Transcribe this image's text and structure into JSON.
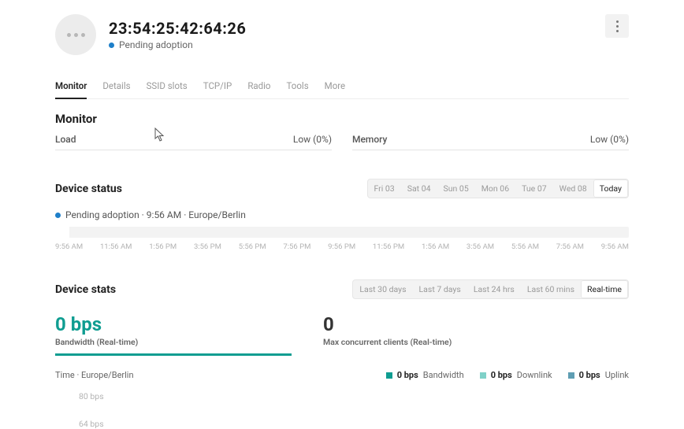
{
  "header": {
    "mac": "23:54:25:42:64:26",
    "status": "Pending adoption"
  },
  "tabs": [
    "Monitor",
    "Details",
    "SSID slots",
    "TCP/IP",
    "Radio",
    "Tools",
    "More"
  ],
  "active_tab": "Monitor",
  "section_monitor_title": "Monitor",
  "meters": {
    "load_label": "Load",
    "load_value": "Low (0%)",
    "memory_label": "Memory",
    "memory_value": "Low (0%)"
  },
  "device_status": {
    "title": "Device status",
    "days": [
      "Fri 03",
      "Sat 04",
      "Sun 05",
      "Mon 06",
      "Tue 07",
      "Wed 08",
      "Today"
    ],
    "active_day": "Today",
    "row_text": "Pending adoption · 9:56 AM · Europe/Berlin",
    "times": [
      "9:56 AM",
      "11:56 AM",
      "1:56 PM",
      "3:56 PM",
      "5:56 PM",
      "7:56 PM",
      "9:56 PM",
      "11:56 PM",
      "1:56 AM",
      "3:56 AM",
      "5:56 AM",
      "7:56 AM",
      "9:56 AM"
    ]
  },
  "device_stats": {
    "title": "Device stats",
    "ranges": [
      "Last 30 days",
      "Last 7 days",
      "Last 24 hrs",
      "Last 60 mins",
      "Real-time"
    ],
    "active_range": "Real-time",
    "bandwidth_value": "0 bps",
    "bandwidth_label": "Bandwidth (Real-time)",
    "clients_value": "0",
    "clients_label": "Max concurrent clients (Real-time)",
    "time_label": "Time · Europe/Berlin",
    "legend": {
      "bw_val": "0 bps",
      "bw_label": "Bandwidth",
      "dl_val": "0 bps",
      "dl_label": "Downlink",
      "ul_val": "0 bps",
      "ul_label": "Uplink"
    },
    "y_ticks": [
      "80 bps",
      "64 bps"
    ]
  },
  "chart_data": {
    "type": "line",
    "title": "Bandwidth (Real-time)",
    "xlabel": "Time · Europe/Berlin",
    "ylabel": "bps",
    "ylim": [
      0,
      80
    ],
    "series": [
      {
        "name": "Bandwidth",
        "values": []
      },
      {
        "name": "Downlink",
        "values": []
      },
      {
        "name": "Uplink",
        "values": []
      }
    ],
    "x": []
  }
}
